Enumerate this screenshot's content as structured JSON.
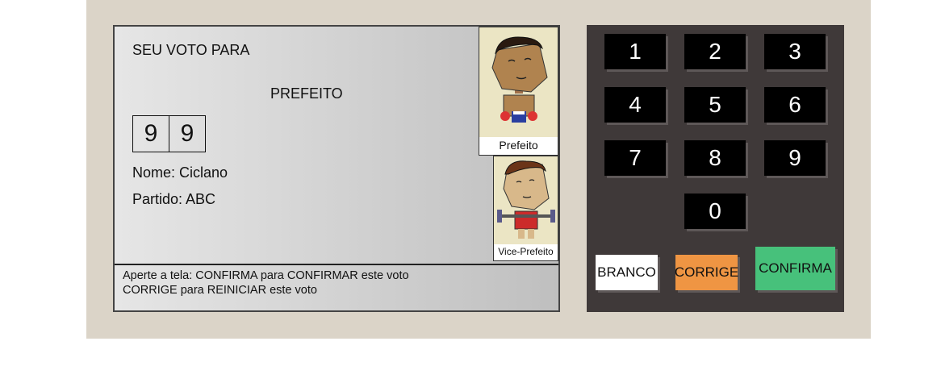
{
  "screen": {
    "heading": "SEU VOTO PARA",
    "office": "PREFEITO",
    "digits": [
      "9",
      "9"
    ],
    "name_line": "Nome: Ciclano",
    "party_line": "Partido: ABC",
    "photos": {
      "mayor_caption": "Prefeito",
      "vice_caption": "Vice-Prefeito"
    },
    "instructions": {
      "line1": "Aperte a tela: CONFIRMA para CONFIRMAR este voto",
      "line2": "CORRIGE para REINICIAR este voto"
    }
  },
  "keypad": {
    "keys": [
      "1",
      "2",
      "3",
      "4",
      "5",
      "6",
      "7",
      "8",
      "9",
      "0"
    ],
    "branco_label": "BRANCO",
    "corrige_label": "CORRIGE",
    "confirma_label": "CONFIRMA"
  },
  "colors": {
    "branco": "#ffffff",
    "corrige": "#ef9543",
    "confirma": "#47c17b",
    "keypad_bg": "#3f3939",
    "urna_bg": "#dbd4c8"
  }
}
